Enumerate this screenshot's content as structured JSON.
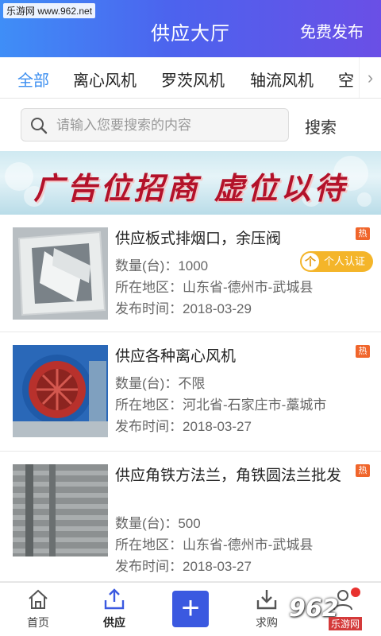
{
  "watermark": "乐游网 www.962.net",
  "header": {
    "title": "供应大厅",
    "action": "免费发布"
  },
  "tabs": [
    "全部",
    "离心风机",
    "罗茨风机",
    "轴流风机",
    "空"
  ],
  "search": {
    "placeholder": "请输入您要搜索的内容",
    "button": "搜索"
  },
  "banner": {
    "text": "广告位招商  虚位以待"
  },
  "items": [
    {
      "title": "供应板式排烟口，余压阀",
      "qty": "数量(台)：1000",
      "location": "所在地区：山东省-德州市-武城县",
      "date": "发布时间：2018-03-29",
      "badge": "热"
    },
    {
      "title": "供应各种离心风机",
      "qty": "数量(台)：不限",
      "location": "所在地区：河北省-石家庄市-藁城市",
      "date": "发布时间：2018-03-27",
      "badge": "热"
    },
    {
      "title": "供应角铁方法兰，角铁圆法兰批发",
      "qty": "数量(台)：500",
      "location": "所在地区：山东省-德州市-武城县",
      "date": "发布时间：2018-03-27",
      "badge": "热"
    }
  ],
  "verify_badge": {
    "label": "个人认证",
    "icon_text": "个"
  },
  "bottom_nav": [
    {
      "label": "首页",
      "icon": "home-icon"
    },
    {
      "label": "供应",
      "icon": "supply-icon"
    },
    {
      "label": "",
      "icon": "plus-icon"
    },
    {
      "label": "求购",
      "icon": "download-icon"
    },
    {
      "label": "",
      "icon": "user-icon"
    }
  ],
  "logo": {
    "main": "962",
    "sub": "乐游网"
  },
  "colors": {
    "header_start": "#3f8ef7",
    "header_end": "#6a4fe6",
    "accent": "#3d8ff0",
    "hot": "#f0652b",
    "verify": "#f4b52a"
  }
}
